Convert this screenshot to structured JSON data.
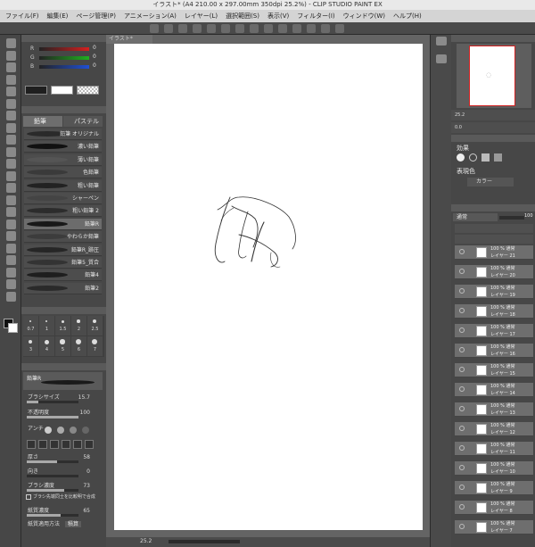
{
  "window": {
    "title": "イラスト* (A4 210.00 x 297.00mm 350dpi 25.2%) - CLIP STUDIO PAINT EX"
  },
  "menu": [
    "ファイル(F)",
    "編集(E)",
    "ページ管理(P)",
    "アニメーション(A)",
    "レイヤー(L)",
    "選択範囲(S)",
    "表示(V)",
    "フィルター(I)",
    "ウィンドウ(W)",
    "ヘルプ(H)"
  ],
  "canvas": {
    "tab_label": "イラスト*"
  },
  "color_slider": {
    "r": "0",
    "g": "0",
    "b": "0"
  },
  "subtool": {
    "tabs": [
      "鉛筆",
      "パステル"
    ],
    "brushes": [
      "鉛筆 オリジナル",
      "濃い鉛筆",
      "薄い鉛筆",
      "色鉛筆",
      "粗い鉛筆",
      "シャーペン",
      "粗い鉛筆 2",
      "鉛筆R",
      "やわらか鉛筆",
      "鉛筆R_跡圧",
      "鉛筆5_質合",
      "鉛筆4",
      "鉛筆2"
    ],
    "selected_index": 7
  },
  "brush_size_palette": {
    "values": [
      "0.7",
      "1",
      "1.5",
      "2",
      "2.5",
      "3",
      "4",
      "5",
      "6",
      "7"
    ]
  },
  "tool_property": {
    "tool_name": "鉛筆R",
    "brush_size": {
      "label": "ブラシサイズ",
      "value": "15.7"
    },
    "opacity": {
      "label": "不透明度",
      "value": "100"
    },
    "antialias": {
      "label": "アンチ"
    },
    "thickness": {
      "label": "厚さ",
      "value": "58"
    },
    "direction": {
      "label": "向き",
      "value": "0"
    },
    "density": {
      "label": "ブラシ濃度",
      "value": "73"
    },
    "checkbox": {
      "label": "ブラシ先端同士を比較明で合成"
    },
    "paper_density": {
      "label": "紙質濃度",
      "value": "65"
    },
    "paper_apply": {
      "label": "紙質適用方法",
      "value": "積算"
    }
  },
  "navigator": {
    "zoom": "25.2",
    "rotation": "0.0"
  },
  "layer_property": {
    "effect_label": "効果",
    "expression_color_label": "表現色",
    "color_value": "カラー"
  },
  "layer_panel": {
    "blend": "通常",
    "opacity": "100",
    "layers": [
      {
        "blend": "100 % 通常",
        "name": "レイヤー 21"
      },
      {
        "blend": "100 % 通常",
        "name": "レイヤー 20"
      },
      {
        "blend": "100 % 通常",
        "name": "レイヤー 19"
      },
      {
        "blend": "100 % 通常",
        "name": "レイヤー 18"
      },
      {
        "blend": "100 % 通常",
        "name": "レイヤー 17"
      },
      {
        "blend": "100 % 通常",
        "name": "レイヤー 16"
      },
      {
        "blend": "100 % 通常",
        "name": "レイヤー 15"
      },
      {
        "blend": "100 % 通常",
        "name": "レイヤー 14"
      },
      {
        "blend": "100 % 通常",
        "name": "レイヤー 13"
      },
      {
        "blend": "100 % 通常",
        "name": "レイヤー 12"
      },
      {
        "blend": "100 % 通常",
        "name": "レイヤー 11"
      },
      {
        "blend": "100 % 通常",
        "name": "レイヤー 10"
      },
      {
        "blend": "100 % 通常",
        "name": "レイヤー 9"
      },
      {
        "blend": "100 % 通常",
        "name": "レイヤー 8"
      },
      {
        "blend": "100 % 通常",
        "name": "レイヤー 7"
      }
    ]
  },
  "status": {
    "zoom": "25.2"
  }
}
